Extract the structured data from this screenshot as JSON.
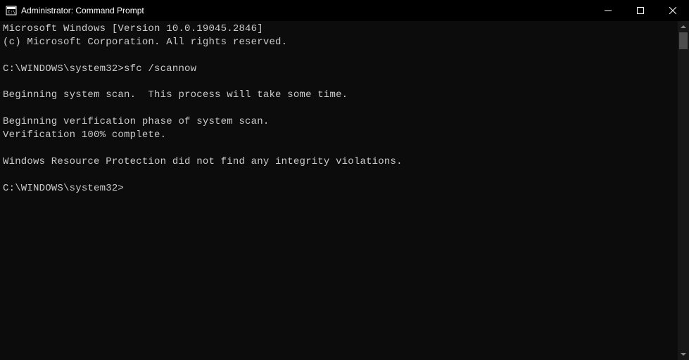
{
  "window": {
    "title": "Administrator: Command Prompt"
  },
  "terminal": {
    "header_line1": "Microsoft Windows [Version 10.0.19045.2846]",
    "header_line2": "(c) Microsoft Corporation. All rights reserved.",
    "prompt1": "C:\\WINDOWS\\system32>",
    "command1": "sfc /scannow",
    "out_line1": "Beginning system scan.  This process will take some time.",
    "out_line2": "Beginning verification phase of system scan.",
    "out_line3": "Verification 100% complete.",
    "out_line4": "Windows Resource Protection did not find any integrity violations.",
    "prompt2": "C:\\WINDOWS\\system32>"
  }
}
